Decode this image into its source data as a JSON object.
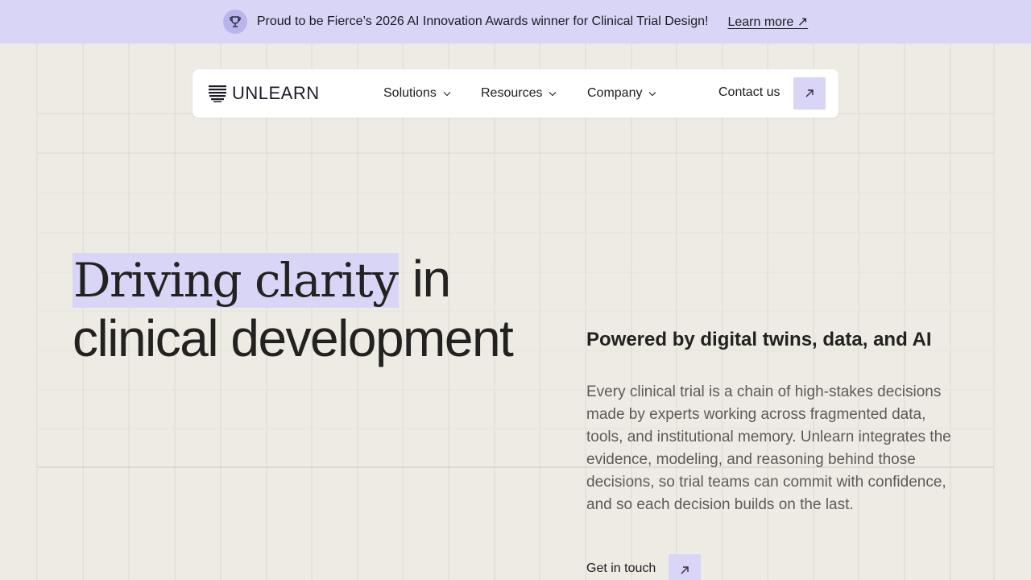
{
  "announcement": {
    "text": "Proud to be Fierce’s 2026 AI Innovation Awards winner for Clinical Trial Design!",
    "link_label": "Learn more ↗",
    "icon": "trophy-icon"
  },
  "nav": {
    "logo_text": "UNLEARN",
    "items": [
      {
        "label": "Solutions"
      },
      {
        "label": "Resources"
      },
      {
        "label": "Company"
      }
    ],
    "contact_label": "Contact us",
    "arrow_icon": "arrow-up-right-icon"
  },
  "hero": {
    "headline_highlight": "Driving clarity",
    "headline_line1_rest": " in",
    "headline_line2": "clinical development",
    "subhead": "Powered by digital twins, data, and AI",
    "body": "Every clinical trial is a chain of high-stakes decisions made by experts working across fragmented data, tools, and institutional memory. Unlearn integrates the evidence, modeling, and reasoning behind those decisions, so trial teams can commit with confidence, and so each decision builds on the last.",
    "cta_label": "Get in touch"
  },
  "colors": {
    "accent": "#d8d5f6",
    "background": "#eeebe5",
    "text": "#232220",
    "muted_text": "#5e5b57"
  }
}
